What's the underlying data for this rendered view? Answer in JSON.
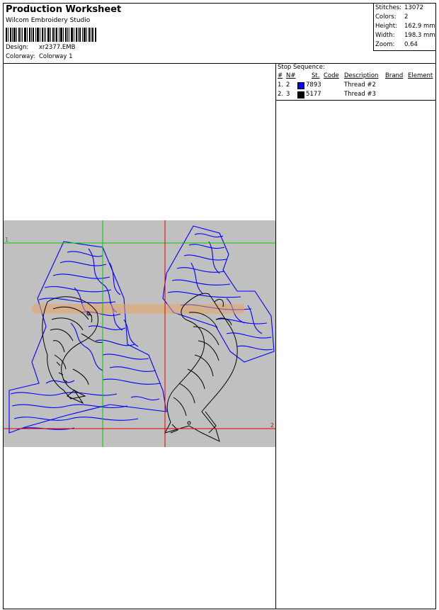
{
  "header": {
    "title": "Production Worksheet",
    "software": "Wilcom Embroidery Studio",
    "design_label": "Design:",
    "design_value": "xr2377.EMB",
    "colorway_label": "Colorway:",
    "colorway_value": "Colorway 1"
  },
  "stats": {
    "stitches_label": "Stitches:",
    "stitches_value": "13072",
    "colors_label": "Colors:",
    "colors_value": "2",
    "height_label": "Height:",
    "height_value": "162.9 mm",
    "width_label": "Width:",
    "width_value": "198.3 mm",
    "zoom_label": "Zoom:",
    "zoom_value": "0.64"
  },
  "stop_sequence": {
    "title": "Stop Sequence:",
    "headers": {
      "num": "#",
      "needle": "N#",
      "st": "St.",
      "code": "Code",
      "description": "Description",
      "brand": "Brand",
      "element": "Element"
    },
    "rows": [
      {
        "num": "1.",
        "needle": "2",
        "code": "7893",
        "description": "Thread #2",
        "color": "#0000ff"
      },
      {
        "num": "2.",
        "needle": "3",
        "code": "5177",
        "description": "Thread #3",
        "color": "#000000"
      }
    ]
  },
  "preview": {
    "background": "#c0c0c0",
    "marker_1": "1",
    "marker_2": "2",
    "guide_green": "#00cc00",
    "guide_red": "#e00000",
    "wave_color": "#0000ff",
    "fish_color": "#000000"
  }
}
